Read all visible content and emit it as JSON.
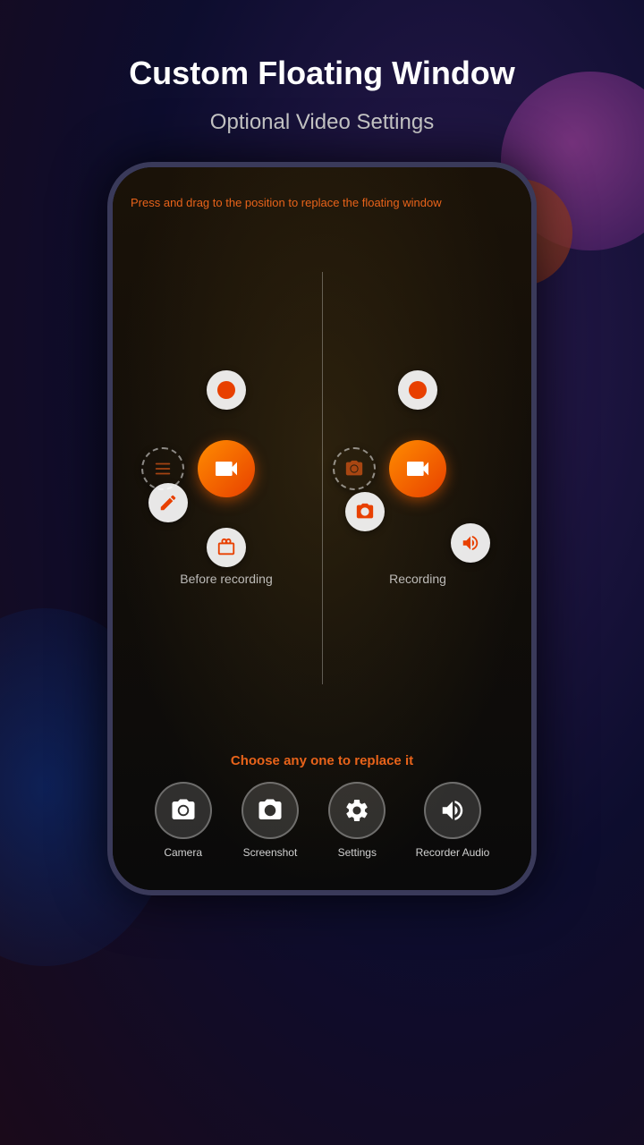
{
  "page": {
    "title": "Custom Floating Window",
    "subtitle": "Optional Video Settings"
  },
  "phone": {
    "instruction": "Press and drag to the position to replace the floating window",
    "before_label": "Before recording",
    "recording_label": "Recording",
    "choose_text": "Choose any one to replace it"
  },
  "choose_items": [
    {
      "id": "camera",
      "label": "Camera",
      "icon": "camera-icon"
    },
    {
      "id": "screenshot",
      "label": "Screenshot",
      "icon": "screenshot-icon"
    },
    {
      "id": "settings",
      "label": "Settings",
      "icon": "settings-icon"
    },
    {
      "id": "recorder-audio",
      "label": "Recorder Audio",
      "icon": "audio-icon"
    }
  ],
  "colors": {
    "accent_orange": "#e8631a",
    "white": "#ffffff",
    "bg_dark": "#1a1a3e"
  }
}
